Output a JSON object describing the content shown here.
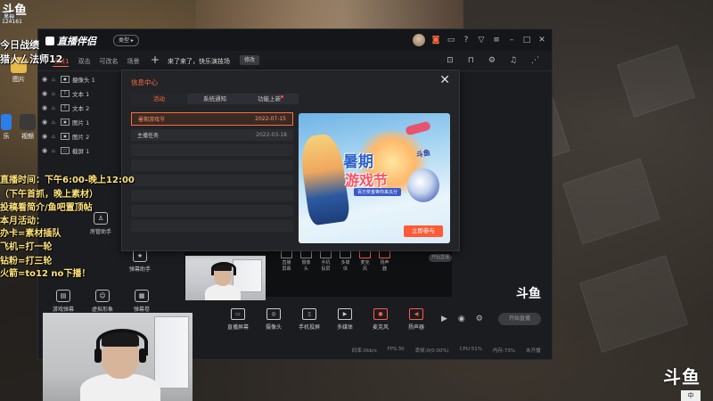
{
  "desktop": {
    "douyu_logo": "斗鱼",
    "user_tag": "黑神",
    "user_id": "124161",
    "overlay": {
      "line1": "今日战绩",
      "line2": "猎人ㄥ法师12",
      "line3": "直播时间：下午6:00-晚上12:00",
      "line4": "（下午首抓，晚上素材）",
      "line5": "投稿看简介/鱼吧置顶帖",
      "line6": "本月活动：",
      "line7": "办卡=素材插队",
      "line8": "飞机=打一轮",
      "line9": "钻粉=打三轮",
      "line10": "火箭=to12 no下播！"
    },
    "icons": [
      {
        "label": "图片",
        "icon": "folder-icon",
        "color": "#e8b948"
      },
      {
        "label": "乐",
        "icon": "music-app-icon",
        "color": "#2b7de9"
      },
      {
        "label": "视频",
        "icon": "video-app-icon",
        "color": "#3a3a3a"
      }
    ],
    "watermark": "斗鱼",
    "ime": "中"
  },
  "app": {
    "brand": "直播伴侣",
    "type_label": "类型",
    "scene_tabs": [
      "场景1",
      "双击",
      "可改名",
      "场景"
    ],
    "live_title": "来了来了，快乐演技场",
    "edit_label": "修改",
    "sources": [
      {
        "name": "摄像头 1",
        "type": "cam"
      },
      {
        "name": "文本 1",
        "type": "T"
      },
      {
        "name": "文本 2",
        "type": "T"
      },
      {
        "name": "图片 1",
        "type": "img"
      },
      {
        "name": "图片 2",
        "type": "img"
      },
      {
        "name": "截屏 1",
        "type": "cap"
      }
    ],
    "tools": [
      {
        "label": "房管助手",
        "icon": "user-manage-icon"
      },
      {
        "label": "弹幕助手",
        "icon": "danmaku-assist-icon"
      },
      {
        "label": "游戏弹幕",
        "icon": "game-danmaku-icon"
      },
      {
        "label": "虚拟形象",
        "icon": "avatar-icon"
      },
      {
        "label": "弹幕卷",
        "icon": "danmaku-roll-icon"
      }
    ],
    "mini_toolbar": [
      "直播屏幕",
      "摄像头",
      "手机投屏",
      "多媒体",
      "麦克风",
      "扬声器"
    ],
    "mini_end": "开始直播",
    "preview_logo": "斗鱼",
    "controls": [
      {
        "label": "直播屏幕",
        "icon": "screen-icon"
      },
      {
        "label": "摄像头",
        "icon": "camera-icon"
      },
      {
        "label": "手机投屏",
        "icon": "phone-cast-icon"
      },
      {
        "label": "多媒体",
        "icon": "media-icon"
      },
      {
        "label": "麦克风",
        "icon": "mic-icon"
      },
      {
        "label": "扬声器",
        "icon": "speaker-icon"
      }
    ],
    "start_live": "开始直播",
    "status": [
      "码率:0kb/s",
      "FPS:30",
      "丢帧:0(0.00%)",
      "CPU:51%",
      "内存:73%",
      "未开播"
    ]
  },
  "modal": {
    "title": "信息中心",
    "tabs": [
      "活动",
      "系统通知",
      "功能上新"
    ],
    "active_tab": 0,
    "messages": [
      {
        "title": "暑期游戏节",
        "date": "2022-07-15",
        "selected": true
      },
      {
        "title": "主播任务",
        "date": "2022-03-18",
        "selected": false
      }
    ],
    "banner": {
      "title1": "暑期",
      "title2": "游戏节",
      "tag": "百万奖金等你来瓜分",
      "side": "斗鱼",
      "button": "立即参与"
    }
  }
}
